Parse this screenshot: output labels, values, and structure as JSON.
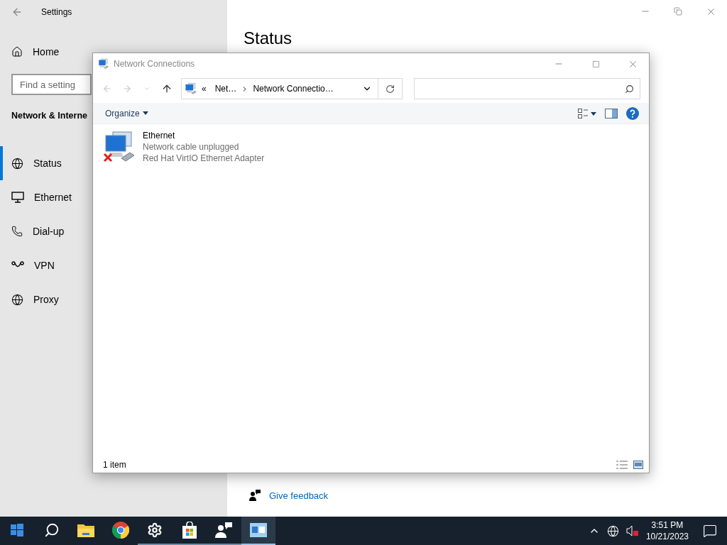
{
  "settings": {
    "title": "Settings",
    "home": "Home",
    "search": {
      "placeholder": "Find a setting"
    },
    "section": "Network & Interne",
    "nav": [
      {
        "kind": "status",
        "label": "Status",
        "selected": true
      },
      {
        "kind": "ethernet",
        "label": "Ethernet",
        "selected": false
      },
      {
        "kind": "dialup",
        "label": "Dial-up",
        "selected": false
      },
      {
        "kind": "vpn",
        "label": "VPN",
        "selected": false
      },
      {
        "kind": "proxy",
        "label": "Proxy",
        "selected": false
      }
    ],
    "page_title": "Status",
    "links": [
      {
        "label": "Give feedback"
      }
    ]
  },
  "explorer": {
    "title": "Network Connections",
    "address": {
      "overflow": "«",
      "parts": [
        "Net…",
        "Network Connectio…"
      ]
    },
    "organize": "Organize",
    "items": [
      {
        "name": "Ethernet",
        "status": "Network cable unplugged",
        "device": "Red Hat VirtIO Ethernet Adapter",
        "connected": false
      }
    ],
    "status_bar": "1 item"
  },
  "taskbar": {
    "apps": [
      {
        "kind": "start",
        "running": false,
        "active": false
      },
      {
        "kind": "search",
        "running": false,
        "active": false
      },
      {
        "kind": "explorer",
        "running": false,
        "active": false
      },
      {
        "kind": "chrome",
        "running": false,
        "active": false
      },
      {
        "kind": "settings",
        "running": true,
        "active": false
      },
      {
        "kind": "store",
        "running": true,
        "active": false
      },
      {
        "kind": "feedback",
        "running": true,
        "active": false
      },
      {
        "kind": "network",
        "running": true,
        "active": true
      }
    ],
    "time": "3:51 PM",
    "date": "10/21/2023"
  }
}
